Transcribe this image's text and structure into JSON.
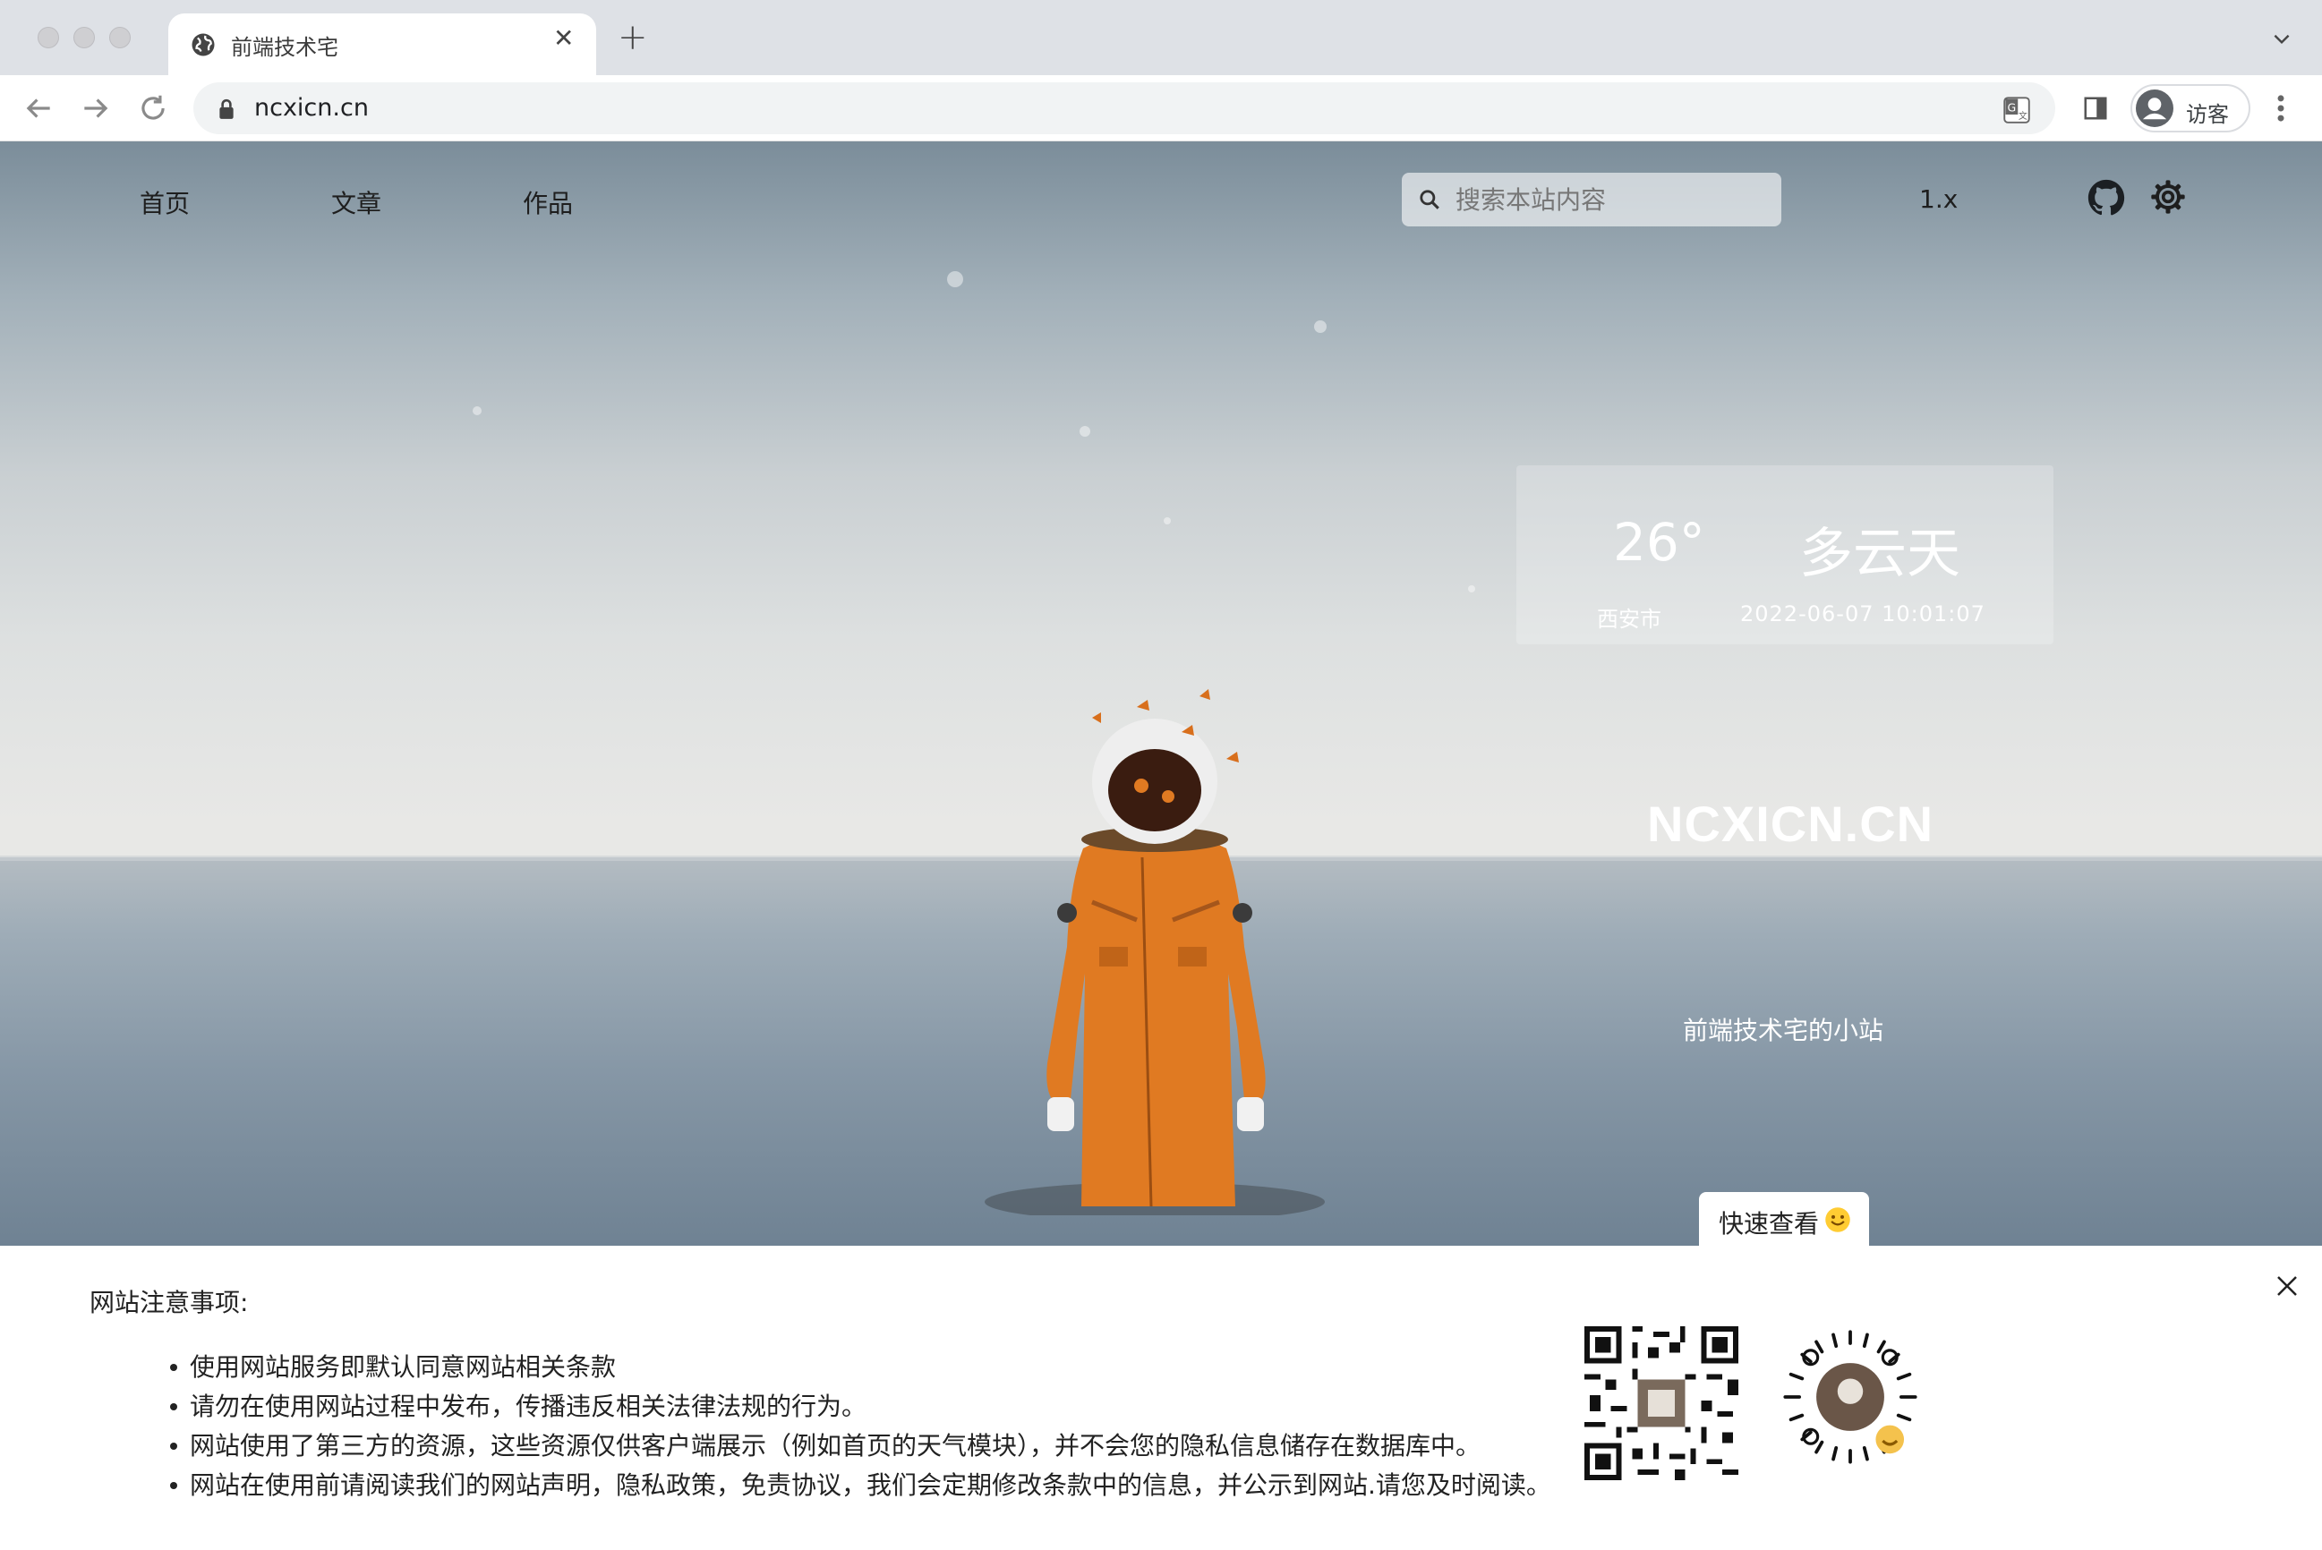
{
  "browser": {
    "tab_title": "前端技术宅",
    "url": "ncxicn.cn",
    "profile_label": "访客"
  },
  "site": {
    "nav": [
      "首页",
      "文章",
      "作品"
    ],
    "search_placeholder": "搜索本站内容",
    "version": "1.x"
  },
  "weather": {
    "temperature": "26°",
    "condition": "多云天",
    "city": "西安市",
    "datetime": "2022-06-07 10:01:07"
  },
  "hero": {
    "brand": "NCXICN.CN",
    "subtitle": "前端技术宅的小站",
    "quick_view": "快速查看"
  },
  "notice": {
    "title": "网站注意事项:",
    "items": [
      "使用网站服务即默认同意网站相关条款",
      "请勿在使用网站过程中发布，传播违反相关法律法规的行为。",
      "网站使用了第三方的资源，这些资源仅供客户端展示（例如首页的天气模块），并不会您的隐私信息储存在数据库中。",
      "网站在使用前请阅读我们的网站声明，隐私政策，免责协议，我们会定期修改条款中的信息，并公示到网站.请您及时阅读。"
    ]
  },
  "icons": [
    "globe-icon",
    "tab-close-icon",
    "new-tab-icon",
    "chevron-down-icon",
    "back-icon",
    "forward-icon",
    "reload-icon",
    "lock-icon",
    "translate-icon",
    "side-panel-icon",
    "avatar-icon",
    "more-vert-icon",
    "search-icon",
    "github-icon",
    "gear-icon",
    "smile-icon",
    "close-icon",
    "qr-code-icon",
    "mini-program-code-icon"
  ],
  "colors": {
    "accent_white": "#ffffff",
    "chrome_bg": "#dee1e6",
    "suit_orange": "#e07a22"
  }
}
